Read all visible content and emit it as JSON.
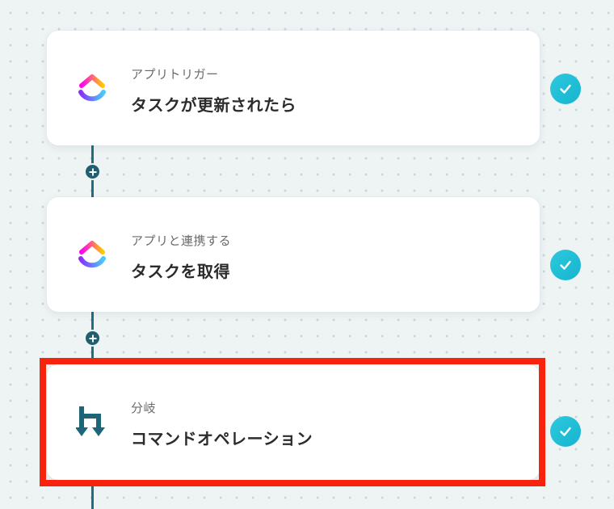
{
  "flow": {
    "steps": [
      {
        "subtitle": "アプリトリガー",
        "title": "タスクが更新されたら",
        "icon": "clickup-logo-icon",
        "status": "completed",
        "selected": false
      },
      {
        "subtitle": "アプリと連携する",
        "title": "タスクを取得",
        "icon": "clickup-logo-icon",
        "status": "completed",
        "selected": false
      },
      {
        "subtitle": "分岐",
        "title": "コマンドオペレーション",
        "icon": "branch-icon",
        "status": "completed",
        "selected": true
      }
    ]
  },
  "colors": {
    "background": "#eef3f4",
    "connector": "#1f6f82",
    "add_dot": "#1f5f70",
    "check": "#1cbdd6",
    "highlight": "#f8230d",
    "branch_icon": "#1d6578"
  }
}
